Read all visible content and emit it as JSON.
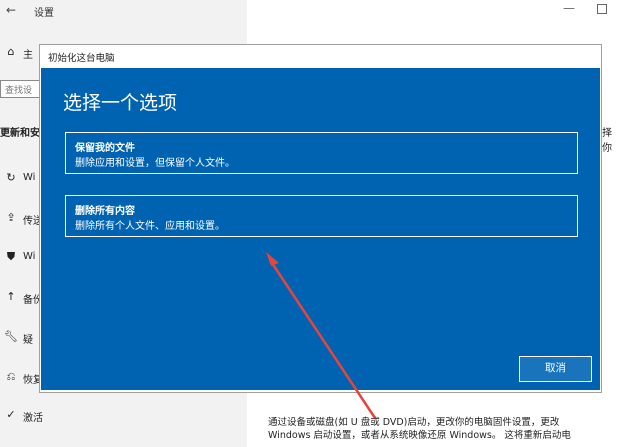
{
  "settings": {
    "title": "设置",
    "back_glyph": "←",
    "home_label": "主",
    "search_placeholder": "查找设",
    "section_heading": "更新和安",
    "sidebar_items": [
      {
        "label": "Wi",
        "icon": "refresh-icon"
      },
      {
        "label": "传送",
        "icon": "upload-icon"
      },
      {
        "label": "Wi",
        "icon": "shield-icon"
      },
      {
        "label": "备份",
        "icon": "backup-icon"
      },
      {
        "label": "疑",
        "icon": "wrench-icon"
      },
      {
        "label": "恢复",
        "icon": "recovery-icon"
      },
      {
        "label": "激活",
        "icon": "check-circle-icon"
      }
    ],
    "right_fragment": "择你",
    "bottom_line1": "通过设备或磁盘(如 U 盘或 DVD)启动，更改你的电脑固件设置，更改",
    "bottom_line2": "Windows 启动设置，或者从系统映像还原 Windows。 这将重新启动电"
  },
  "dialog": {
    "title": "初始化这台电脑",
    "heading": "选择一个选项",
    "options": [
      {
        "title": "保留我的文件",
        "desc": "删除应用和设置，但保留个人文件。"
      },
      {
        "title": "删除所有内容",
        "desc": "删除所有个人文件、应用和设置。"
      }
    ],
    "cancel_label": "取消"
  },
  "colors": {
    "dialog_blue": "#0063b1",
    "annotation_red": "#e8443a"
  }
}
